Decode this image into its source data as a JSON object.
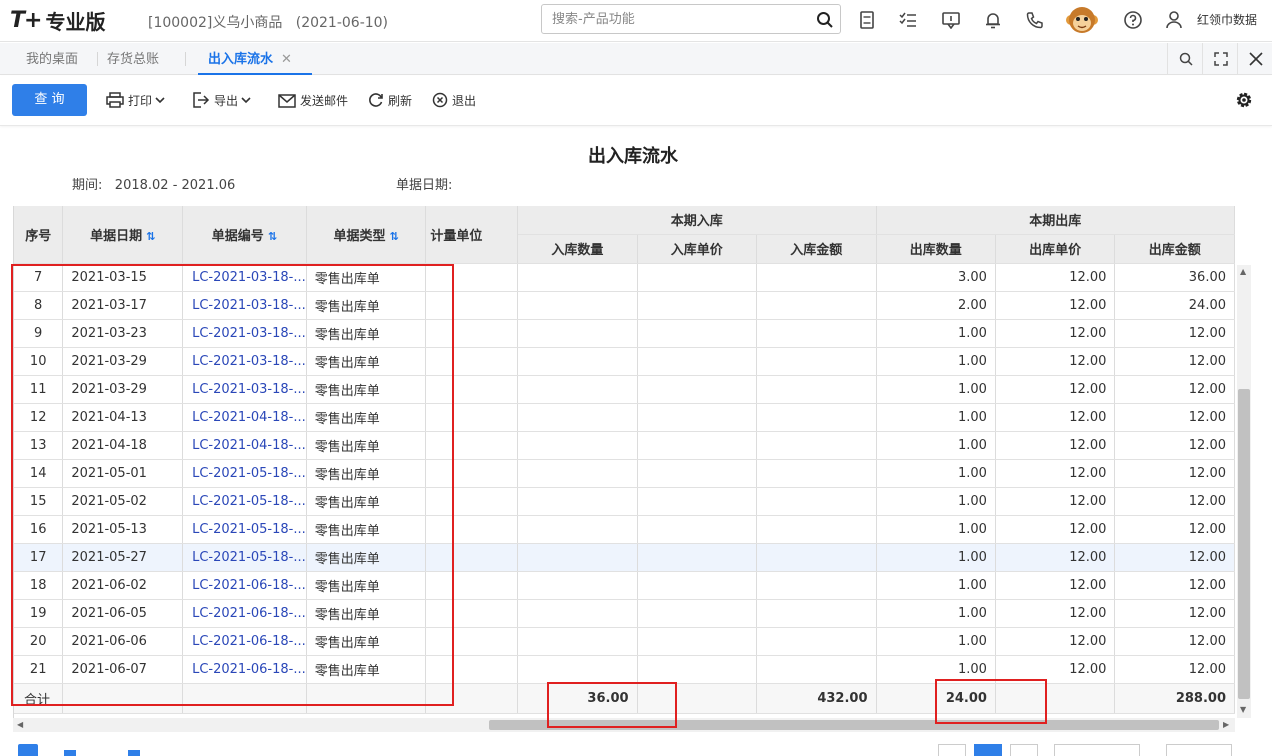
{
  "app": {
    "logo": "T+",
    "edition": "专业版",
    "company": "[100002]义乌小商品",
    "date": "(2021-06-10)"
  },
  "search": {
    "placeholder": "搜索-产品功能"
  },
  "user": {
    "name": "红领巾数据"
  },
  "tabs": [
    {
      "label": "我的桌面"
    },
    {
      "label": "存货总账"
    },
    {
      "label": "出入库流水",
      "active": true
    }
  ],
  "toolbar": {
    "query": "查 询",
    "print": "打印",
    "export": "导出",
    "mail": "发送邮件",
    "refresh": "刷新",
    "exit": "退出"
  },
  "report": {
    "title": "出入库流水",
    "period_label": "期间:",
    "period_value": "2018.02 - 2021.06",
    "billdate_label": "单据日期:"
  },
  "columns": {
    "seq": "序号",
    "date": "单据日期",
    "no": "单据编号",
    "type": "单据类型",
    "unit": "计量单位",
    "in_group": "本期入库",
    "in_qty": "入库数量",
    "in_price": "入库单价",
    "in_amt": "入库金额",
    "out_group": "本期出库",
    "out_qty": "出库数量",
    "out_price": "出库单价",
    "out_amt": "出库金额"
  },
  "rows": [
    {
      "seq": "7",
      "date": "2021-03-15",
      "no": "LC-2021-03-18-...",
      "type": "零售出库单",
      "out_qty": "3.00",
      "out_price": "12.00",
      "out_amt": "36.00"
    },
    {
      "seq": "8",
      "date": "2021-03-17",
      "no": "LC-2021-03-18-...",
      "type": "零售出库单",
      "out_qty": "2.00",
      "out_price": "12.00",
      "out_amt": "24.00"
    },
    {
      "seq": "9",
      "date": "2021-03-23",
      "no": "LC-2021-03-18-...",
      "type": "零售出库单",
      "out_qty": "1.00",
      "out_price": "12.00",
      "out_amt": "12.00"
    },
    {
      "seq": "10",
      "date": "2021-03-29",
      "no": "LC-2021-03-18-...",
      "type": "零售出库单",
      "out_qty": "1.00",
      "out_price": "12.00",
      "out_amt": "12.00"
    },
    {
      "seq": "11",
      "date": "2021-03-29",
      "no": "LC-2021-03-18-...",
      "type": "零售出库单",
      "out_qty": "1.00",
      "out_price": "12.00",
      "out_amt": "12.00"
    },
    {
      "seq": "12",
      "date": "2021-04-13",
      "no": "LC-2021-04-18-...",
      "type": "零售出库单",
      "out_qty": "1.00",
      "out_price": "12.00",
      "out_amt": "12.00"
    },
    {
      "seq": "13",
      "date": "2021-04-18",
      "no": "LC-2021-04-18-...",
      "type": "零售出库单",
      "out_qty": "1.00",
      "out_price": "12.00",
      "out_amt": "12.00"
    },
    {
      "seq": "14",
      "date": "2021-05-01",
      "no": "LC-2021-05-18-...",
      "type": "零售出库单",
      "out_qty": "1.00",
      "out_price": "12.00",
      "out_amt": "12.00"
    },
    {
      "seq": "15",
      "date": "2021-05-02",
      "no": "LC-2021-05-18-...",
      "type": "零售出库单",
      "out_qty": "1.00",
      "out_price": "12.00",
      "out_amt": "12.00"
    },
    {
      "seq": "16",
      "date": "2021-05-13",
      "no": "LC-2021-05-18-...",
      "type": "零售出库单",
      "out_qty": "1.00",
      "out_price": "12.00",
      "out_amt": "12.00"
    },
    {
      "seq": "17",
      "date": "2021-05-27",
      "no": "LC-2021-05-18-...",
      "type": "零售出库单",
      "out_qty": "1.00",
      "out_price": "12.00",
      "out_amt": "12.00",
      "highlight": true
    },
    {
      "seq": "18",
      "date": "2021-06-02",
      "no": "LC-2021-06-18-...",
      "type": "零售出库单",
      "out_qty": "1.00",
      "out_price": "12.00",
      "out_amt": "12.00"
    },
    {
      "seq": "19",
      "date": "2021-06-05",
      "no": "LC-2021-06-18-...",
      "type": "零售出库单",
      "out_qty": "1.00",
      "out_price": "12.00",
      "out_amt": "12.00"
    },
    {
      "seq": "20",
      "date": "2021-06-06",
      "no": "LC-2021-06-18-...",
      "type": "零售出库单",
      "out_qty": "1.00",
      "out_price": "12.00",
      "out_amt": "12.00"
    },
    {
      "seq": "21",
      "date": "2021-06-07",
      "no": "LC-2021-06-18-...",
      "type": "零售出库单",
      "out_qty": "1.00",
      "out_price": "12.00",
      "out_amt": "12.00"
    }
  ],
  "totals": {
    "label": "合计",
    "in_qty": "36.00",
    "in_amt": "432.00",
    "out_qty": "24.00",
    "out_amt": "288.00"
  },
  "colors": {
    "accent": "#2f7fe8",
    "link": "#2a47b8",
    "annotation": "#e02020"
  }
}
